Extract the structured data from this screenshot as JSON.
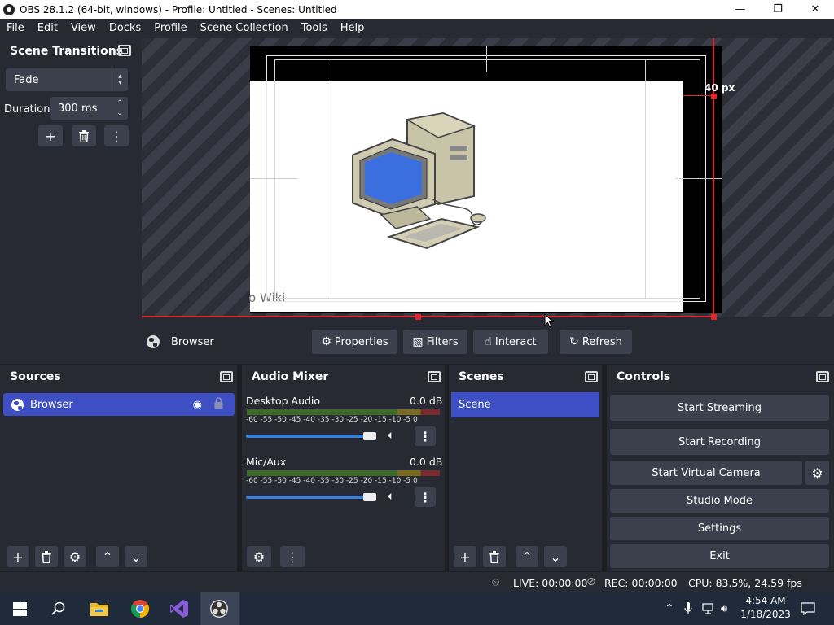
{
  "window": {
    "title": "OBS 28.1.2 (64-bit, windows) - Profile: Untitled - Scenes: Untitled"
  },
  "menu": [
    "File",
    "Edit",
    "View",
    "Docks",
    "Profile",
    "Scene Collection",
    "Tools",
    "Help"
  ],
  "transitions": {
    "title": "Scene Transitions",
    "selected": "Fade",
    "duration_label": "Duration",
    "duration_value": "300 ms"
  },
  "preview": {
    "distance_label": "40 px",
    "page_text": "o Wiki"
  },
  "source_toolbar": {
    "source_name": "Browser",
    "properties": "Properties",
    "filters": "Filters",
    "interact": "Interact",
    "refresh": "Refresh"
  },
  "sources": {
    "title": "Sources",
    "items": [
      {
        "name": "Browser"
      }
    ]
  },
  "audio_mixer": {
    "title": "Audio Mixer",
    "ticks": "-60 -55 -50 -45 -40 -35 -30 -25 -20 -15 -10  -5   0",
    "channels": [
      {
        "name": "Desktop Audio",
        "level": "0.0 dB",
        "volume": 0.95
      },
      {
        "name": "Mic/Aux",
        "level": "0.0 dB",
        "volume": 0.95
      }
    ]
  },
  "scenes": {
    "title": "Scenes",
    "items": [
      "Scene"
    ]
  },
  "controls": {
    "title": "Controls",
    "start_streaming": "Start Streaming",
    "start_recording": "Start Recording",
    "start_virtual_camera": "Start Virtual Camera",
    "studio_mode": "Studio Mode",
    "settings": "Settings",
    "exit": "Exit"
  },
  "status": {
    "live": "LIVE: 00:00:00",
    "rec": "REC: 00:00:00",
    "cpu": "CPU: 83.5%, 24.59 fps"
  },
  "taskbar": {
    "time": "4:54 AM",
    "date": "1/18/2023"
  },
  "colors": {
    "accent": "#3d4fc2",
    "selection_red": "#e2262e",
    "panel": "#272a33",
    "button": "#3c404d"
  }
}
